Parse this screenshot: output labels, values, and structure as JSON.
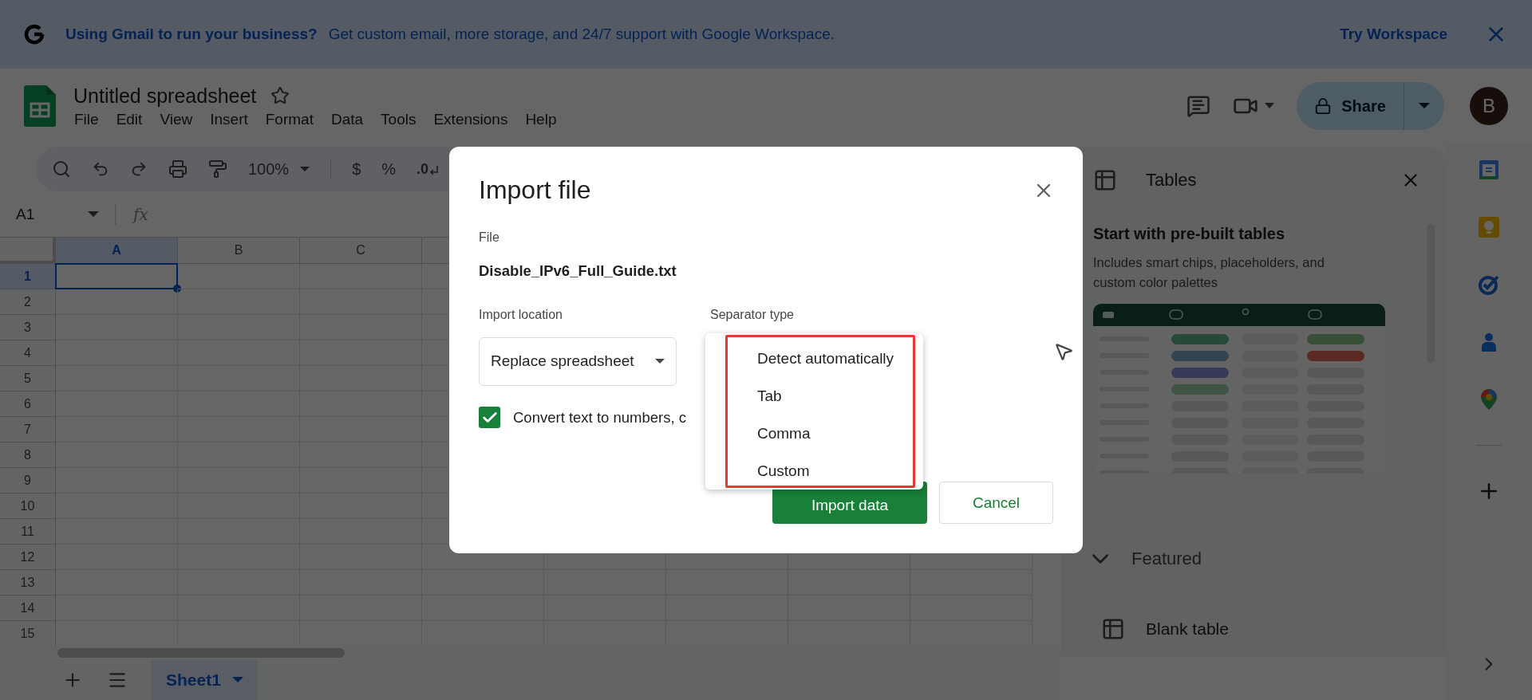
{
  "banner": {
    "headline": "Using Gmail to run your business?",
    "text": "Get custom email, more storage, and 24/7 support with Google Workspace.",
    "action": "Try Workspace"
  },
  "document": {
    "title": "Untitled spreadsheet",
    "starred": false
  },
  "menu_bar": [
    "File",
    "Edit",
    "View",
    "Insert",
    "Format",
    "Data",
    "Tools",
    "Extensions",
    "Help"
  ],
  "header_actions": {
    "share": "Share",
    "avatar": "B"
  },
  "toolbar": {
    "zoom": "100%",
    "currency": "$",
    "percent": "%",
    "decrease_decimals": ".0"
  },
  "formula_bar": {
    "cell_ref": "A1",
    "function_label": "fx"
  },
  "grid": {
    "columns": [
      {
        "label": "A",
        "selected": true
      },
      {
        "label": "B",
        "selected": false
      },
      {
        "label": "C",
        "selected": false
      }
    ],
    "rows": [
      {
        "label": "1",
        "selected": true
      },
      {
        "label": "2",
        "selected": false
      },
      {
        "label": "3",
        "selected": false
      },
      {
        "label": "4",
        "selected": false
      },
      {
        "label": "5",
        "selected": false
      },
      {
        "label": "6",
        "selected": false
      },
      {
        "label": "7",
        "selected": false
      },
      {
        "label": "8",
        "selected": false
      },
      {
        "label": "9",
        "selected": false
      },
      {
        "label": "10",
        "selected": false
      },
      {
        "label": "11",
        "selected": false
      },
      {
        "label": "12",
        "selected": false
      },
      {
        "label": "13",
        "selected": false
      },
      {
        "label": "14",
        "selected": false
      },
      {
        "label": "15",
        "selected": false
      }
    ]
  },
  "sheet_tabs": [
    {
      "label": "Sheet1",
      "selected": true
    }
  ],
  "tables_panel": {
    "title": "Tables",
    "heading": "Start with pre-built tables",
    "description": "Includes smart chips, placeholders, and custom color palettes",
    "section": {
      "label": "Featured",
      "expanded": true
    },
    "items": [
      "Blank table"
    ]
  },
  "dialog": {
    "title": "Import file",
    "file_label": "File",
    "file_name": "Disable_IPv6_Full_Guide.txt",
    "location_label": "Import location",
    "location_value": "Replace spreadsheet",
    "separator_label": "Separator type",
    "convert": {
      "label": "Convert text to numbers, c",
      "checked": true
    },
    "separator_options": [
      {
        "label": "Detect automatically"
      },
      {
        "label": "Tab"
      },
      {
        "label": "Comma"
      },
      {
        "label": "Custom"
      }
    ],
    "primary_button": "Import data",
    "secondary_button": "Cancel"
  }
}
